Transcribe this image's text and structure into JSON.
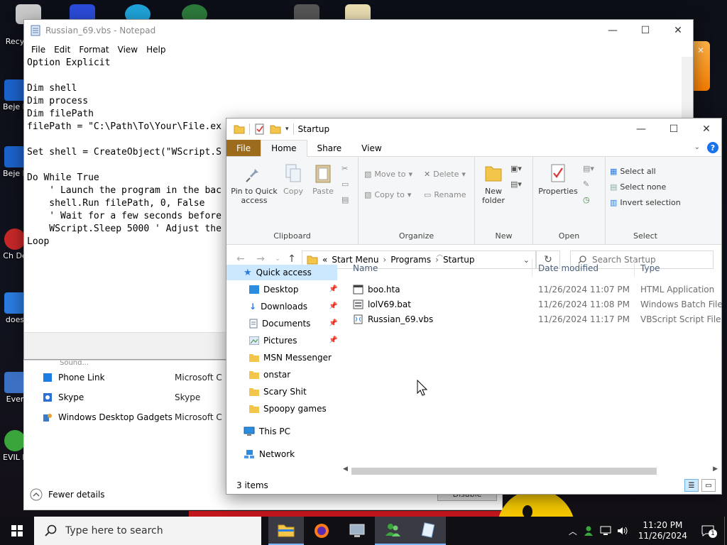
{
  "desktop": {
    "icons": [
      {
        "label": "Recy"
      },
      {
        "label": "Beje De"
      },
      {
        "label": "Beje De"
      },
      {
        "label": "Ch De"
      },
      {
        "label": "does"
      },
      {
        "label": "Ever"
      },
      {
        "label": "EVIL MEN"
      }
    ]
  },
  "notepad": {
    "title": "Russian_69.vbs - Notepad",
    "menu": [
      "File",
      "Edit",
      "Format",
      "View",
      "Help"
    ],
    "content": "Option Explicit\n\nDim shell\nDim process\nDim filePath\nfilePath = \"C:\\Path\\To\\Your\\File.ex\n\nSet shell = CreateObject(\"WScript.S\n\nDo While True\n    ' Launch the program in the bac\n    shell.Run filePath, 0, False\n    ' Wait for a few seconds before\n    WScript.Sleep 5000 ' Adjust the\nLoop"
  },
  "programs": {
    "partial_row": "Sound...",
    "rows": [
      {
        "name": "Phone Link",
        "publisher": "Microsoft C",
        "icon_color": "#1e7de3"
      },
      {
        "name": "Skype",
        "publisher": "Skype",
        "icon_color": "#2a6fd6"
      },
      {
        "name": "Windows Desktop Gadgets",
        "publisher": "Microsoft C",
        "icon_color": "#3b7ac9"
      }
    ],
    "fewer_details": "Fewer details",
    "disable": "Disable"
  },
  "explorer": {
    "title": "Startup",
    "tabs": [
      "File",
      "Home",
      "Share",
      "View"
    ],
    "ribbon": {
      "clipboard": {
        "label": "Clipboard",
        "pin": "Pin to Quick access",
        "copy": "Copy",
        "paste": "Paste"
      },
      "organize": {
        "label": "Organize",
        "move_to": "Move to",
        "copy_to": "Copy to",
        "delete": "Delete",
        "rename": "Rename"
      },
      "new": {
        "label": "New",
        "new_folder": "New folder"
      },
      "open": {
        "label": "Open",
        "properties": "Properties"
      },
      "select": {
        "label": "Select",
        "select_all": "Select all",
        "select_none": "Select none",
        "invert": "Invert selection"
      }
    },
    "address": {
      "prefix": "«",
      "crumbs": [
        "Start Menu",
        "Programs",
        "Startup"
      ],
      "search_placeholder": "Search Startup"
    },
    "nav": {
      "quick_access": "Quick access",
      "items": [
        {
          "label": "Desktop",
          "pinned": true
        },
        {
          "label": "Downloads",
          "pinned": true
        },
        {
          "label": "Documents",
          "pinned": true
        },
        {
          "label": "Pictures",
          "pinned": true
        },
        {
          "label": "MSN Messenger",
          "pinned": false
        },
        {
          "label": "onstar",
          "pinned": false
        },
        {
          "label": "Scary Shit",
          "pinned": false
        },
        {
          "label": "Spoopy games",
          "pinned": false
        }
      ],
      "this_pc": "This PC",
      "network": "Network"
    },
    "columns": {
      "name": "Name",
      "date": "Date modified",
      "type": "Type"
    },
    "files": [
      {
        "name": "boo.hta",
        "date": "11/26/2024 11:07 PM",
        "type": "HTML Application"
      },
      {
        "name": "lolV69.bat",
        "date": "11/26/2024 11:08 PM",
        "type": "Windows Batch File"
      },
      {
        "name": "Russian_69.vbs",
        "date": "11/26/2024 11:17 PM",
        "type": "VBScript Script File"
      }
    ],
    "status": "3 items"
  },
  "taskbar": {
    "search_placeholder": "Type here to search",
    "time": "11:20 PM",
    "date": "11/26/2024",
    "notification_count": "1"
  },
  "colors": {
    "file_tab": "#9c6b1b",
    "selection": "#cce8ff",
    "folder": "#f3c54a",
    "accent_blue": "#1a73e8"
  }
}
